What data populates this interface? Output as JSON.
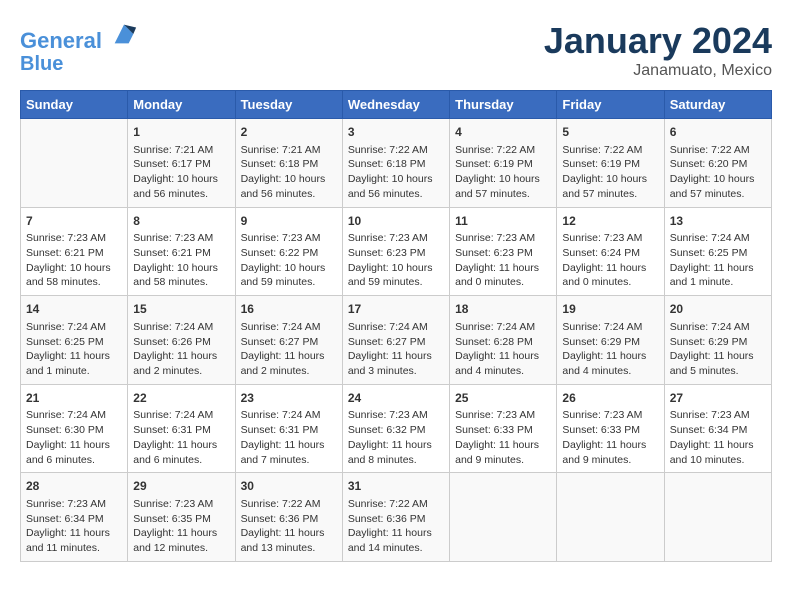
{
  "header": {
    "logo_line1": "General",
    "logo_line2": "Blue",
    "month": "January 2024",
    "location": "Janamuato, Mexico"
  },
  "weekdays": [
    "Sunday",
    "Monday",
    "Tuesday",
    "Wednesday",
    "Thursday",
    "Friday",
    "Saturday"
  ],
  "weeks": [
    [
      {
        "day": "",
        "info": ""
      },
      {
        "day": "1",
        "info": "Sunrise: 7:21 AM\nSunset: 6:17 PM\nDaylight: 10 hours\nand 56 minutes."
      },
      {
        "day": "2",
        "info": "Sunrise: 7:21 AM\nSunset: 6:18 PM\nDaylight: 10 hours\nand 56 minutes."
      },
      {
        "day": "3",
        "info": "Sunrise: 7:22 AM\nSunset: 6:18 PM\nDaylight: 10 hours\nand 56 minutes."
      },
      {
        "day": "4",
        "info": "Sunrise: 7:22 AM\nSunset: 6:19 PM\nDaylight: 10 hours\nand 57 minutes."
      },
      {
        "day": "5",
        "info": "Sunrise: 7:22 AM\nSunset: 6:19 PM\nDaylight: 10 hours\nand 57 minutes."
      },
      {
        "day": "6",
        "info": "Sunrise: 7:22 AM\nSunset: 6:20 PM\nDaylight: 10 hours\nand 57 minutes."
      }
    ],
    [
      {
        "day": "7",
        "info": "Sunrise: 7:23 AM\nSunset: 6:21 PM\nDaylight: 10 hours\nand 58 minutes."
      },
      {
        "day": "8",
        "info": "Sunrise: 7:23 AM\nSunset: 6:21 PM\nDaylight: 10 hours\nand 58 minutes."
      },
      {
        "day": "9",
        "info": "Sunrise: 7:23 AM\nSunset: 6:22 PM\nDaylight: 10 hours\nand 59 minutes."
      },
      {
        "day": "10",
        "info": "Sunrise: 7:23 AM\nSunset: 6:23 PM\nDaylight: 10 hours\nand 59 minutes."
      },
      {
        "day": "11",
        "info": "Sunrise: 7:23 AM\nSunset: 6:23 PM\nDaylight: 11 hours\nand 0 minutes."
      },
      {
        "day": "12",
        "info": "Sunrise: 7:23 AM\nSunset: 6:24 PM\nDaylight: 11 hours\nand 0 minutes."
      },
      {
        "day": "13",
        "info": "Sunrise: 7:24 AM\nSunset: 6:25 PM\nDaylight: 11 hours\nand 1 minute."
      }
    ],
    [
      {
        "day": "14",
        "info": "Sunrise: 7:24 AM\nSunset: 6:25 PM\nDaylight: 11 hours\nand 1 minute."
      },
      {
        "day": "15",
        "info": "Sunrise: 7:24 AM\nSunset: 6:26 PM\nDaylight: 11 hours\nand 2 minutes."
      },
      {
        "day": "16",
        "info": "Sunrise: 7:24 AM\nSunset: 6:27 PM\nDaylight: 11 hours\nand 2 minutes."
      },
      {
        "day": "17",
        "info": "Sunrise: 7:24 AM\nSunset: 6:27 PM\nDaylight: 11 hours\nand 3 minutes."
      },
      {
        "day": "18",
        "info": "Sunrise: 7:24 AM\nSunset: 6:28 PM\nDaylight: 11 hours\nand 4 minutes."
      },
      {
        "day": "19",
        "info": "Sunrise: 7:24 AM\nSunset: 6:29 PM\nDaylight: 11 hours\nand 4 minutes."
      },
      {
        "day": "20",
        "info": "Sunrise: 7:24 AM\nSunset: 6:29 PM\nDaylight: 11 hours\nand 5 minutes."
      }
    ],
    [
      {
        "day": "21",
        "info": "Sunrise: 7:24 AM\nSunset: 6:30 PM\nDaylight: 11 hours\nand 6 minutes."
      },
      {
        "day": "22",
        "info": "Sunrise: 7:24 AM\nSunset: 6:31 PM\nDaylight: 11 hours\nand 6 minutes."
      },
      {
        "day": "23",
        "info": "Sunrise: 7:24 AM\nSunset: 6:31 PM\nDaylight: 11 hours\nand 7 minutes."
      },
      {
        "day": "24",
        "info": "Sunrise: 7:23 AM\nSunset: 6:32 PM\nDaylight: 11 hours\nand 8 minutes."
      },
      {
        "day": "25",
        "info": "Sunrise: 7:23 AM\nSunset: 6:33 PM\nDaylight: 11 hours\nand 9 minutes."
      },
      {
        "day": "26",
        "info": "Sunrise: 7:23 AM\nSunset: 6:33 PM\nDaylight: 11 hours\nand 9 minutes."
      },
      {
        "day": "27",
        "info": "Sunrise: 7:23 AM\nSunset: 6:34 PM\nDaylight: 11 hours\nand 10 minutes."
      }
    ],
    [
      {
        "day": "28",
        "info": "Sunrise: 7:23 AM\nSunset: 6:34 PM\nDaylight: 11 hours\nand 11 minutes."
      },
      {
        "day": "29",
        "info": "Sunrise: 7:23 AM\nSunset: 6:35 PM\nDaylight: 11 hours\nand 12 minutes."
      },
      {
        "day": "30",
        "info": "Sunrise: 7:22 AM\nSunset: 6:36 PM\nDaylight: 11 hours\nand 13 minutes."
      },
      {
        "day": "31",
        "info": "Sunrise: 7:22 AM\nSunset: 6:36 PM\nDaylight: 11 hours\nand 14 minutes."
      },
      {
        "day": "",
        "info": ""
      },
      {
        "day": "",
        "info": ""
      },
      {
        "day": "",
        "info": ""
      }
    ]
  ]
}
